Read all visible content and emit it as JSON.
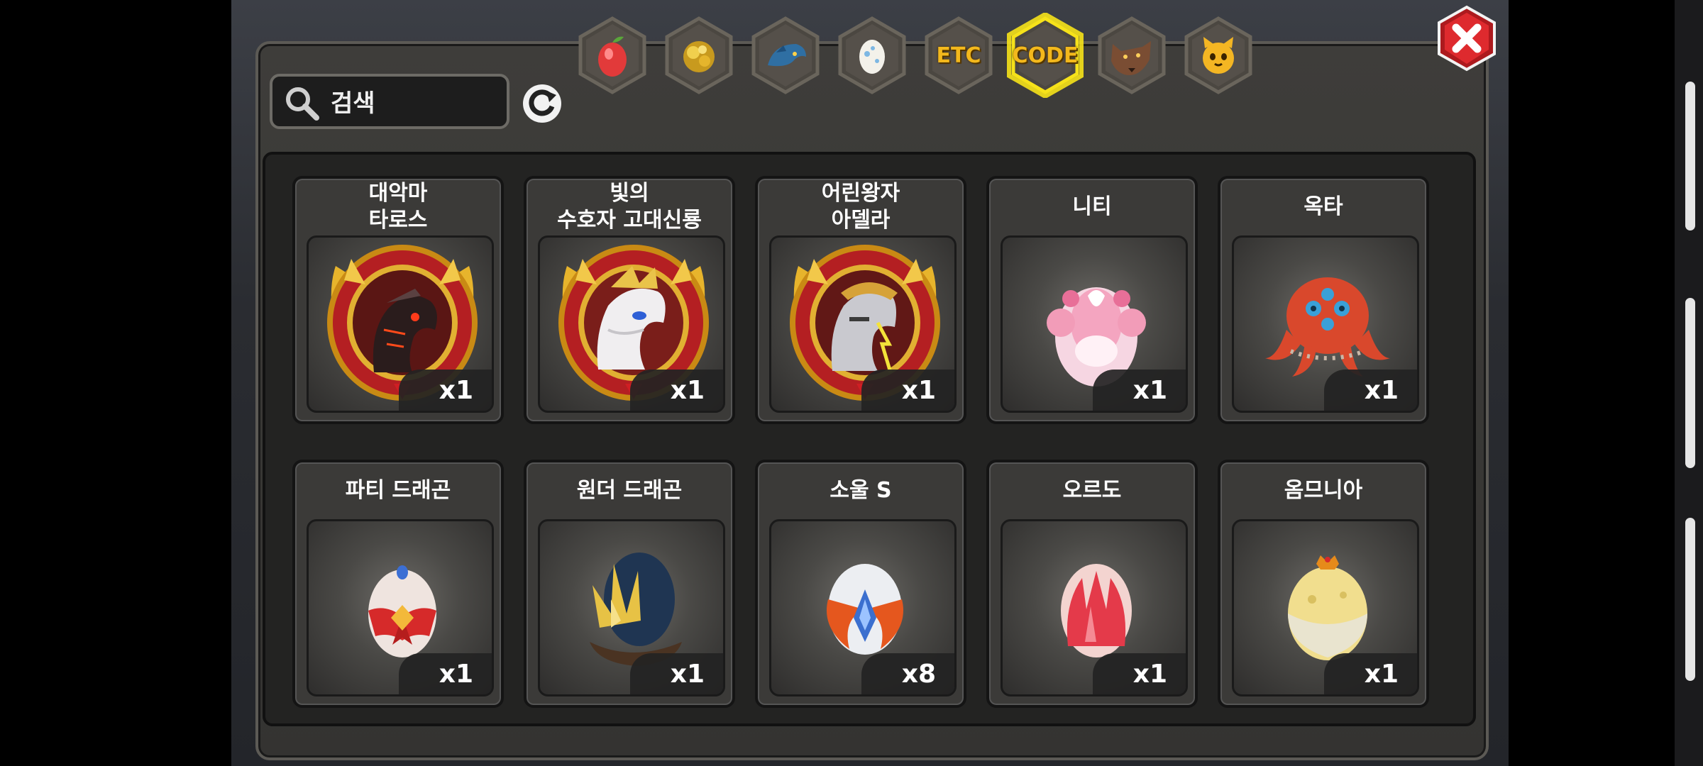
{
  "search": {
    "placeholder": "검색",
    "value": ""
  },
  "tabs": [
    {
      "id": "fruit",
      "label": "",
      "icon": "fruit-icon",
      "active": false
    },
    {
      "id": "material",
      "label": "",
      "icon": "gold-nugget-icon",
      "active": false
    },
    {
      "id": "dragon",
      "label": "",
      "icon": "dragon-head-icon",
      "active": false
    },
    {
      "id": "egg",
      "label": "",
      "icon": "egg-icon",
      "active": false
    },
    {
      "id": "etc",
      "label": "ETC",
      "icon": "",
      "active": false
    },
    {
      "id": "code",
      "label": "CODE",
      "icon": "",
      "active": true
    },
    {
      "id": "beast",
      "label": "",
      "icon": "wolf-icon",
      "active": false
    },
    {
      "id": "cat",
      "label": "",
      "icon": "cat-face-icon",
      "active": false
    }
  ],
  "items": [
    {
      "name": "대악마\n타로스",
      "quantity": "x1",
      "art": "crest-dark-dragon"
    },
    {
      "name": "빛의\n수호자 고대신룡",
      "quantity": "x1",
      "art": "crest-white-dragon"
    },
    {
      "name": "어린왕자\n아델라",
      "quantity": "x1",
      "art": "crest-armored-dragon"
    },
    {
      "name": "니티",
      "quantity": "x1",
      "art": "pink-egg-creature"
    },
    {
      "name": "옥타",
      "quantity": "x1",
      "art": "octopus"
    },
    {
      "name": "파티 드래곤",
      "quantity": "x1",
      "art": "egg-ribbon"
    },
    {
      "name": "원더 드래곤",
      "quantity": "x1",
      "art": "egg-spiky-nest"
    },
    {
      "name": "소울 S",
      "quantity": "x8",
      "art": "egg-winged"
    },
    {
      "name": "오르도",
      "quantity": "x1",
      "art": "egg-red-crystal"
    },
    {
      "name": "옴므니아",
      "quantity": "x1",
      "art": "egg-crowned"
    }
  ],
  "colors": {
    "tab_gold": "#f3b81c",
    "active_glow": "#f6e21a",
    "close_red": "#d8262b"
  }
}
